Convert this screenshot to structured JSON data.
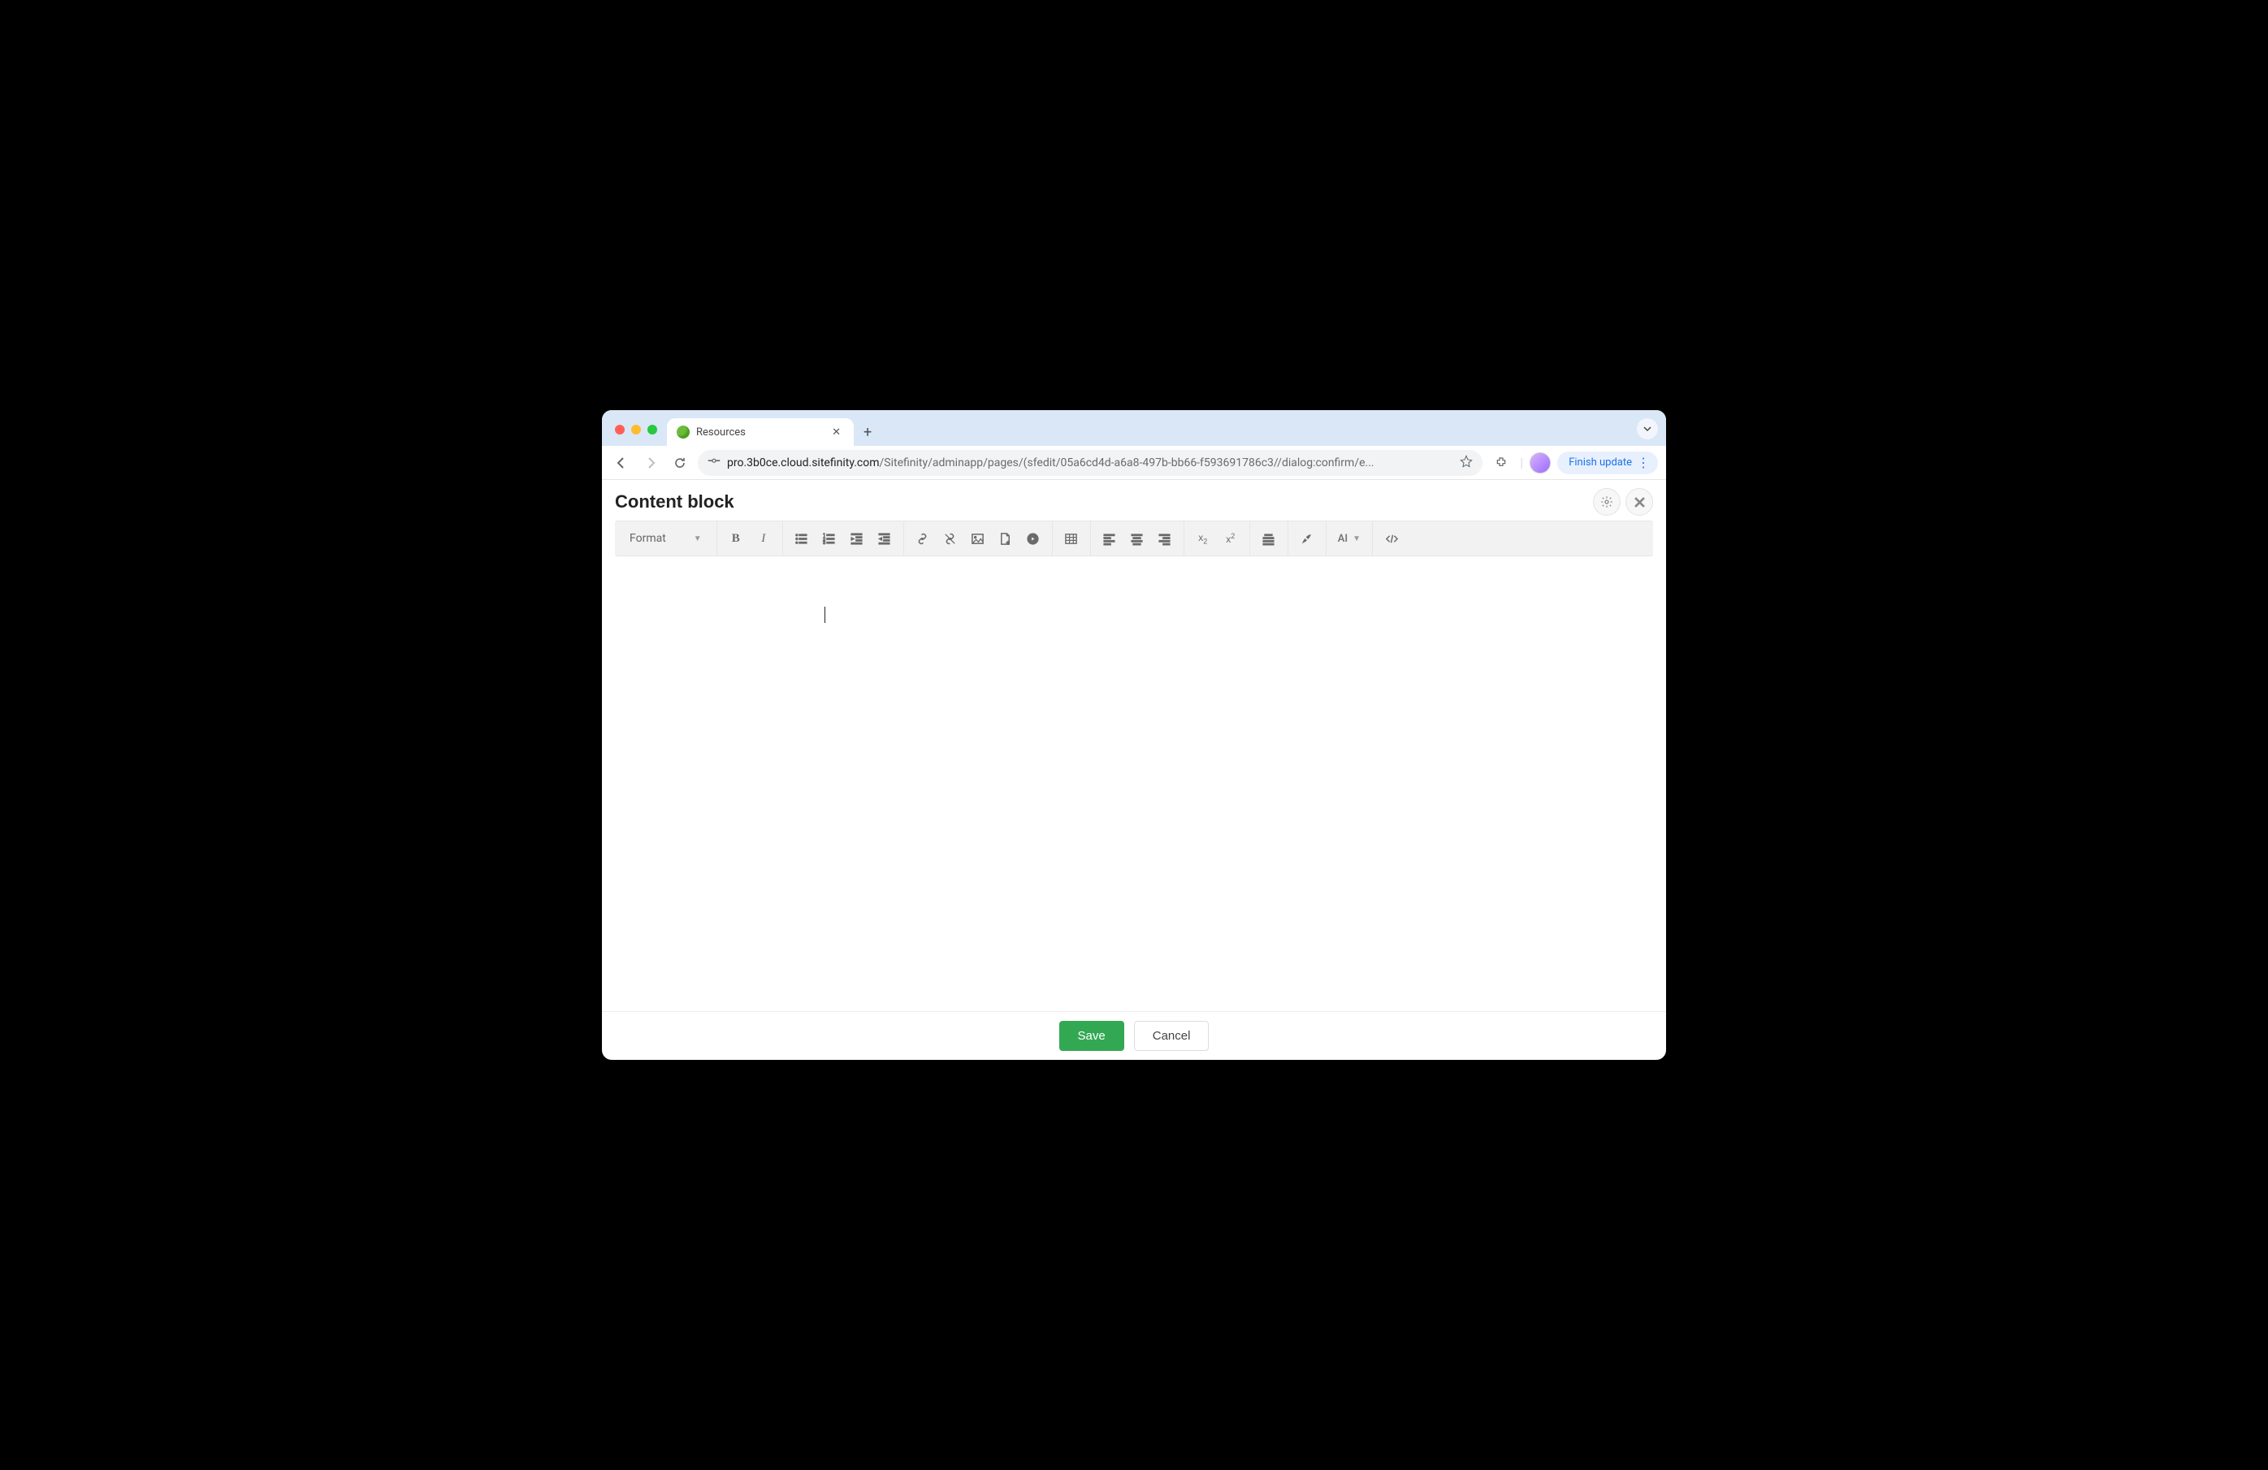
{
  "browser": {
    "tab_title": "Resources",
    "url_dark": "pro.3b0ce.cloud.sitefinity.com",
    "url_dim": "/Sitefinity/adminapp/pages/(sfedit/05a6cd4d-a6a8-497b-bb66-f593691786c3//dialog:confirm/e...",
    "finish_update": "Finish update"
  },
  "header": {
    "title": "Content block"
  },
  "toolbar": {
    "format_label": "Format",
    "ai_label": "AI"
  },
  "footer": {
    "save": "Save",
    "cancel": "Cancel"
  }
}
